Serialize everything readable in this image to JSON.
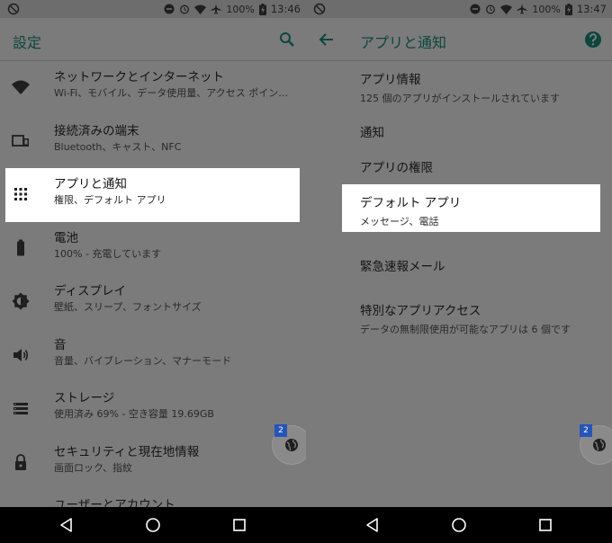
{
  "left": {
    "status": {
      "battery": "100%",
      "time": "13:46"
    },
    "appbar": {
      "title": "設定"
    },
    "items": [
      {
        "title": "ネットワークとインターネット",
        "sub": "Wi-Fi、モバイル、データ使用量、アクセス ポイン…",
        "icon": "wifi-icon"
      },
      {
        "title": "接続済みの端末",
        "sub": "Bluetooth、キャスト、NFC",
        "icon": "devices-icon"
      },
      {
        "title": "アプリと通知",
        "sub": "権限、デフォルト アプリ",
        "icon": "apps-grid-icon"
      },
      {
        "title": "電池",
        "sub": "100% - 充電しています",
        "icon": "battery-icon"
      },
      {
        "title": "ディスプレイ",
        "sub": "壁紙、スリープ、フォントサイズ",
        "icon": "brightness-icon"
      },
      {
        "title": "音",
        "sub": "音量、バイブレーション、マナーモード",
        "icon": "volume-icon"
      },
      {
        "title": "ストレージ",
        "sub": "使用済み 69% - 空き容量 19.69GB",
        "icon": "storage-icon"
      },
      {
        "title": "セキュリティと現在地情報",
        "sub": "画面ロック、指紋",
        "icon": "lock-icon"
      },
      {
        "title": "ユーザーとアカウント",
        "sub": "",
        "icon": "account-icon"
      }
    ],
    "bubble_badge": "2"
  },
  "right": {
    "status": {
      "battery": "100%",
      "time": "13:47"
    },
    "appbar": {
      "title": "アプリと通知"
    },
    "items": [
      {
        "title": "アプリ情報",
        "sub": "125 個のアプリがインストールされています"
      },
      {
        "title": "通知",
        "sub": ""
      },
      {
        "title": "アプリの権限",
        "sub": ""
      },
      {
        "title": "デフォルト アプリ",
        "sub": "メッセージ、電話"
      },
      {
        "title": "緊急速報メール",
        "sub": ""
      },
      {
        "title": "特別なアプリアクセス",
        "sub": "データの無制限使用が可能なアプリは 6 個です"
      }
    ],
    "bubble_badge": "2"
  },
  "colors": {
    "accent": "#0c463d",
    "dim_background": "#7b7b7b",
    "highlight": "#ffffff",
    "badge": "#2654b8"
  }
}
